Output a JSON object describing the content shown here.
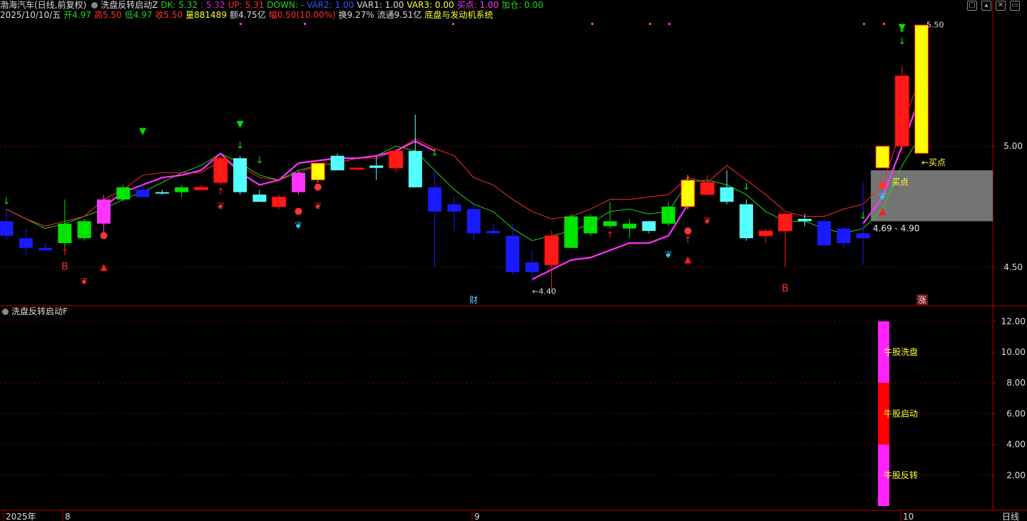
{
  "header": {
    "stock": "渤海汽车(日线,前复权)",
    "indicator_main": "洗盘反转启动Z",
    "params": [
      {
        "label": "DK: 5.32",
        "color": "#22d322"
      },
      {
        "label": ": 5.32",
        "color": "#d81ec9"
      },
      {
        "label": "UP: 5.31",
        "color": "#ff2a2a"
      },
      {
        "label": "DOWN: -",
        "color": "#22d322"
      },
      {
        "label": "VAR2: 1.00",
        "color": "#3355ff"
      },
      {
        "label": "VAR1: 1.00",
        "color": "#dddddd"
      },
      {
        "label": "VAR3: 0.00",
        "color": "#ffff33"
      },
      {
        "label": "买点: 1.00",
        "color": "#ff33ff"
      },
      {
        "label": "加仓: 0.00",
        "color": "#22d322"
      }
    ],
    "quote": [
      {
        "label": "2025/10/10/五",
        "color": "#dddddd"
      },
      {
        "label": "开4.97",
        "color": "#22d322"
      },
      {
        "label": "高5.50",
        "color": "#ff3333"
      },
      {
        "label": "低4.97",
        "color": "#22d322"
      },
      {
        "label": "收5.50",
        "color": "#ff3333"
      },
      {
        "label": "量881489",
        "color": "#ffff33"
      },
      {
        "label": "额4.75亿",
        "color": "#dddddd"
      },
      {
        "label": "幅0.50(10.00%)",
        "color": "#ff3333"
      },
      {
        "label": "换9.27%",
        "color": "#dddddd"
      },
      {
        "label": "流通9.51亿",
        "color": "#dddddd"
      },
      {
        "label": "底盘与发动机系统",
        "color": "#ffff33"
      }
    ],
    "sub_indicator": "洗盘反转启动F"
  },
  "colors": {
    "up": "#ff1a1a",
    "down": "#00e400",
    "blue": "#1a1aff",
    "cyan": "#55ffff",
    "magenta": "#ff33ff",
    "yellow": "#ffff00",
    "grid": "#7a0000",
    "axis": "#b00000",
    "ma": "#22d322",
    "ema": "#ff2a2a"
  },
  "chart_data": [
    {
      "type": "candlestick",
      "title": "",
      "ylim": [
        4.38,
        5.55
      ],
      "y_ticks": [
        4.5,
        5.0
      ],
      "candles": [
        {
          "o": 4.69,
          "h": 4.74,
          "l": 4.61,
          "c": 4.63,
          "col": "blue"
        },
        {
          "o": 4.62,
          "h": 4.66,
          "l": 4.55,
          "c": 4.58,
          "col": "blue"
        },
        {
          "o": 4.58,
          "h": 4.6,
          "l": 4.57,
          "c": 4.57,
          "col": "blue"
        },
        {
          "o": 4.6,
          "h": 4.78,
          "l": 4.58,
          "c": 4.68,
          "col": "green"
        },
        {
          "o": 4.62,
          "h": 4.7,
          "l": 4.61,
          "c": 4.69,
          "col": "green"
        },
        {
          "o": 4.68,
          "h": 4.8,
          "l": 4.63,
          "c": 4.78,
          "col": "magenta"
        },
        {
          "o": 4.78,
          "h": 4.84,
          "l": 4.77,
          "c": 4.83,
          "col": "green"
        },
        {
          "o": 4.82,
          "h": 4.84,
          "l": 4.79,
          "c": 4.79,
          "col": "blue"
        },
        {
          "o": 4.81,
          "h": 4.82,
          "l": 4.8,
          "c": 4.81,
          "col": "cyan"
        },
        {
          "o": 4.81,
          "h": 4.84,
          "l": 4.79,
          "c": 4.83,
          "col": "green"
        },
        {
          "o": 4.83,
          "h": 4.84,
          "l": 4.82,
          "c": 4.82,
          "col": "up"
        },
        {
          "o": 4.85,
          "h": 4.96,
          "l": 4.84,
          "c": 4.95,
          "col": "up"
        },
        {
          "o": 4.95,
          "h": 4.96,
          "l": 4.8,
          "c": 4.81,
          "col": "cyan"
        },
        {
          "o": 4.8,
          "h": 4.82,
          "l": 4.77,
          "c": 4.77,
          "col": "cyan"
        },
        {
          "o": 4.79,
          "h": 4.8,
          "l": 4.74,
          "c": 4.75,
          "col": "up"
        },
        {
          "o": 4.81,
          "h": 4.9,
          "l": 4.8,
          "c": 4.89,
          "col": "magenta"
        },
        {
          "o": 4.86,
          "h": 4.93,
          "l": 4.85,
          "c": 4.93,
          "col": "yellow"
        },
        {
          "o": 4.96,
          "h": 4.97,
          "l": 4.9,
          "c": 4.9,
          "col": "cyan"
        },
        {
          "o": 4.91,
          "h": 4.91,
          "l": 4.91,
          "c": 4.91,
          "col": "up"
        },
        {
          "o": 4.91,
          "h": 4.96,
          "l": 4.86,
          "c": 4.92,
          "col": "cyan"
        },
        {
          "o": 4.91,
          "h": 4.99,
          "l": 4.89,
          "c": 4.98,
          "col": "up"
        },
        {
          "o": 4.98,
          "h": 5.13,
          "l": 4.83,
          "c": 4.83,
          "col": "cyan"
        },
        {
          "o": 4.83,
          "h": 4.9,
          "l": 4.5,
          "c": 4.73,
          "col": "blue"
        },
        {
          "o": 4.73,
          "h": 4.79,
          "l": 4.65,
          "c": 4.76,
          "col": "blue"
        },
        {
          "o": 4.74,
          "h": 4.77,
          "l": 4.61,
          "c": 4.64,
          "col": "blue"
        },
        {
          "o": 4.65,
          "h": 4.68,
          "l": 4.63,
          "c": 4.64,
          "col": "blue"
        },
        {
          "o": 4.63,
          "h": 4.68,
          "l": 4.47,
          "c": 4.48,
          "col": "blue"
        },
        {
          "o": 4.48,
          "h": 4.57,
          "l": 4.44,
          "c": 4.52,
          "col": "blue"
        },
        {
          "o": 4.51,
          "h": 4.65,
          "l": 4.4,
          "c": 4.63,
          "col": "up"
        },
        {
          "o": 4.58,
          "h": 4.72,
          "l": 4.58,
          "c": 4.71,
          "col": "green"
        },
        {
          "o": 4.64,
          "h": 4.72,
          "l": 4.63,
          "c": 4.71,
          "col": "green"
        },
        {
          "o": 4.67,
          "h": 4.77,
          "l": 4.66,
          "c": 4.69,
          "col": "green"
        },
        {
          "o": 4.68,
          "h": 4.7,
          "l": 4.62,
          "c": 4.66,
          "col": "green"
        },
        {
          "o": 4.65,
          "h": 4.69,
          "l": 4.64,
          "c": 4.69,
          "col": "cyan"
        },
        {
          "o": 4.68,
          "h": 4.77,
          "l": 4.67,
          "c": 4.75,
          "col": "green"
        },
        {
          "o": 4.75,
          "h": 4.88,
          "l": 4.74,
          "c": 4.86,
          "col": "yellow"
        },
        {
          "o": 4.85,
          "h": 4.88,
          "l": 4.8,
          "c": 4.8,
          "col": "up"
        },
        {
          "o": 4.83,
          "h": 4.9,
          "l": 4.76,
          "c": 4.77,
          "col": "cyan"
        },
        {
          "o": 4.76,
          "h": 4.78,
          "l": 4.61,
          "c": 4.62,
          "col": "cyan"
        },
        {
          "o": 4.63,
          "h": 4.66,
          "l": 4.6,
          "c": 4.65,
          "col": "up"
        },
        {
          "o": 4.65,
          "h": 4.71,
          "l": 4.5,
          "c": 4.72,
          "col": "up"
        },
        {
          "o": 4.7,
          "h": 4.72,
          "l": 4.67,
          "c": 4.69,
          "col": "cyan"
        },
        {
          "o": 4.69,
          "h": 4.7,
          "l": 4.59,
          "c": 4.59,
          "col": "blue"
        },
        {
          "o": 4.66,
          "h": 4.67,
          "l": 4.58,
          "c": 4.6,
          "col": "blue"
        },
        {
          "o": 4.62,
          "h": 4.85,
          "l": 4.51,
          "c": 4.64,
          "col": "blue"
        },
        {
          "o": 4.91,
          "h": 4.99,
          "l": 4.91,
          "c": 5.0,
          "col": "yellow"
        },
        {
          "o": 5.0,
          "h": 5.33,
          "l": 4.97,
          "c": 5.29,
          "col": "up"
        },
        {
          "o": 4.97,
          "h": 5.5,
          "l": 4.97,
          "c": 5.5,
          "col": "yellow"
        }
      ],
      "ma_line": [
        4.74,
        4.7,
        4.66,
        4.68,
        4.71,
        4.74,
        4.78,
        4.81,
        4.85,
        4.89,
        4.92,
        4.97,
        4.93,
        4.88,
        4.86,
        4.9,
        4.92,
        4.93,
        4.95,
        4.96,
        5.0,
        4.98,
        4.9,
        4.82,
        4.76,
        4.73,
        4.66,
        4.61,
        4.63,
        4.65,
        4.68,
        4.73,
        4.74,
        4.72,
        4.73,
        4.85,
        4.86,
        4.84,
        4.8,
        4.73,
        4.69,
        4.69,
        4.66,
        4.64,
        4.66,
        4.74,
        4.92,
        5.05
      ],
      "ema_line": [
        4.74,
        4.7,
        4.67,
        4.69,
        4.71,
        4.78,
        4.82,
        4.88,
        4.89,
        4.89,
        4.89,
        4.94,
        4.92,
        4.87,
        4.86,
        4.89,
        4.92,
        4.93,
        4.95,
        4.95,
        4.98,
        5.03,
        4.99,
        4.96,
        4.87,
        4.84,
        4.78,
        4.73,
        4.7,
        4.71,
        4.74,
        4.78,
        4.78,
        4.79,
        4.8,
        4.87,
        4.85,
        4.92,
        4.86,
        4.8,
        4.73,
        4.71,
        4.71,
        4.74,
        4.76,
        4.84,
        5.08,
        5.3
      ],
      "mag_line": [
        null,
        null,
        null,
        null,
        null,
        4.75,
        4.81,
        4.84,
        4.87,
        4.88,
        4.9,
        4.97,
        4.89,
        4.84,
        4.86,
        4.93,
        4.94,
        4.95,
        4.95,
        4.96,
        4.98,
        5.02,
        4.98,
        null,
        null,
        null,
        null,
        4.45,
        4.49,
        4.53,
        4.54,
        4.57,
        4.6,
        4.6,
        4.63,
        4.76,
        null,
        null,
        null,
        null,
        null,
        null,
        null,
        null,
        4.68,
        4.79,
        5.0,
        5.22
      ],
      "buy_zone_label": "4.69 - 4.90",
      "buy_zone": [
        4.69,
        4.9
      ],
      "max_label": "5.50",
      "min_label": "4.40",
      "buy_label": "买点",
      "b_markers": [
        "B",
        "B"
      ],
      "event_labels": [
        "财",
        "涨"
      ],
      "x_labels": [
        "2025年",
        "8",
        "9",
        "10"
      ],
      "period": "日线"
    },
    {
      "type": "bar",
      "title": "洗盘反转启动F",
      "ylim": [
        0,
        12.5
      ],
      "y_ticks": [
        2.0,
        4.0,
        6.0,
        8.0,
        10.0,
        12.0
      ],
      "segments": [
        {
          "name": "牛股反转",
          "from": 0,
          "to": 4,
          "color": "#ff22ff"
        },
        {
          "name": "牛股启动",
          "from": 4,
          "to": 8,
          "color": "#ff0000"
        },
        {
          "name": "牛股洗盘",
          "from": 8,
          "to": 12,
          "color": "#ff22ff"
        }
      ]
    }
  ]
}
